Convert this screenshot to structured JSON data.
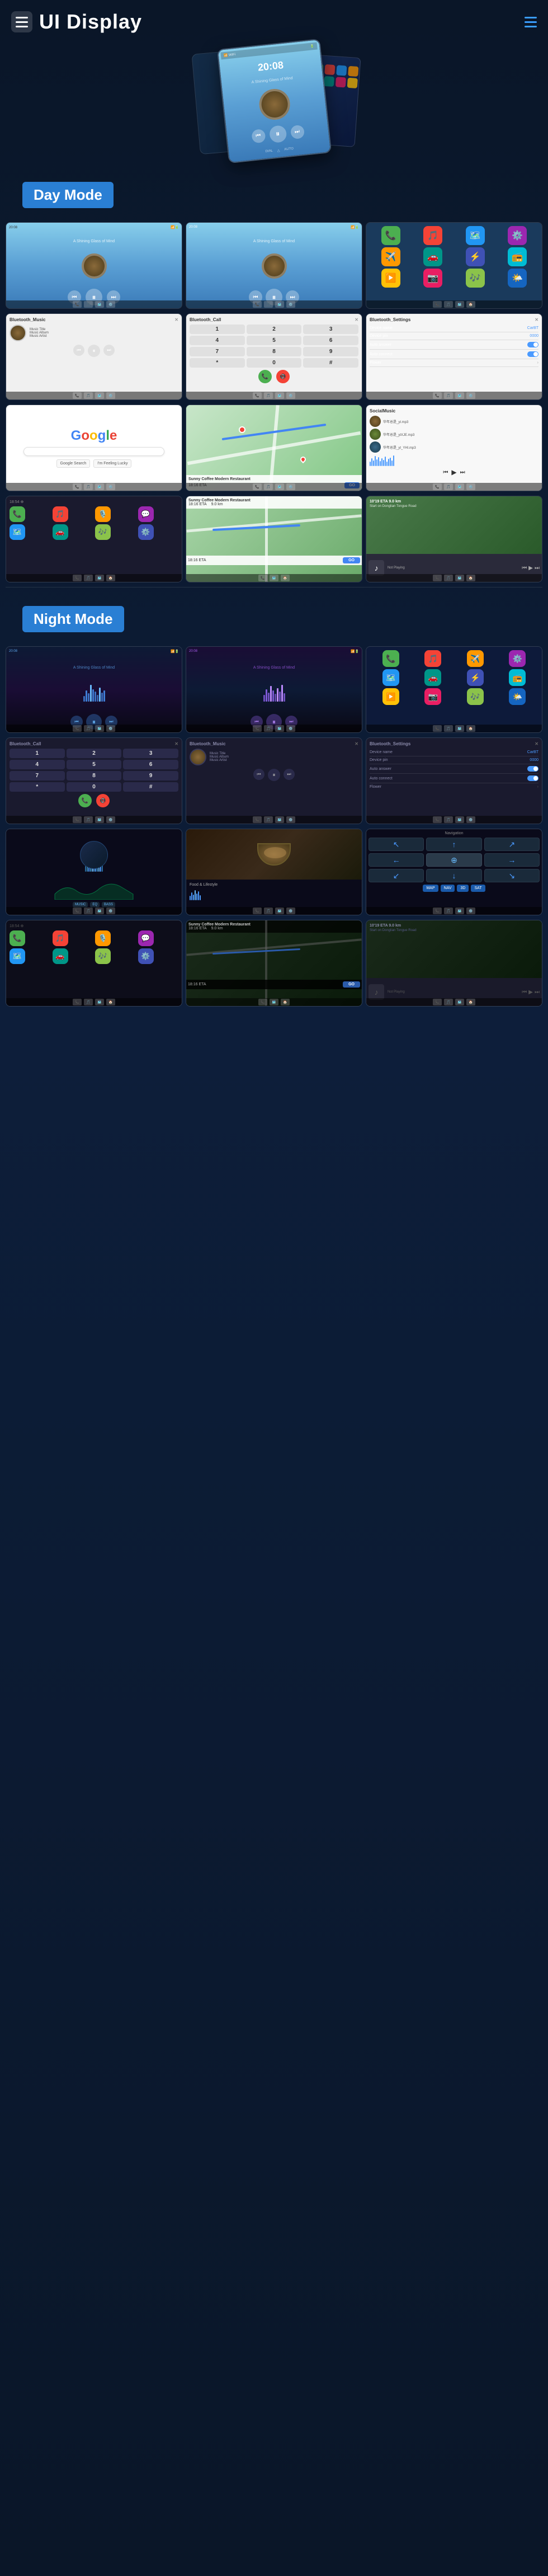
{
  "header": {
    "title": "UI Display",
    "menu_icon_label": "Menu",
    "hamburger_label": "Hamburger Menu"
  },
  "day_mode": {
    "label": "Day Mode",
    "screens": [
      {
        "id": "day-music-1",
        "type": "music",
        "time": "20:08",
        "desc": "Day music player 1"
      },
      {
        "id": "day-music-2",
        "type": "music",
        "time": "20:08",
        "desc": "Day music player 2"
      },
      {
        "id": "day-apps",
        "type": "apps",
        "desc": "App grid"
      },
      {
        "id": "day-bt-music",
        "type": "bt-music",
        "title": "Bluetooth_Music",
        "desc": "Bluetooth music"
      },
      {
        "id": "day-bt-call",
        "type": "bt-call",
        "title": "Bluetooth_Call",
        "desc": "Bluetooth call"
      },
      {
        "id": "day-bt-settings",
        "type": "bt-settings",
        "title": "Bluetooth_Settings",
        "desc": "Bluetooth settings"
      },
      {
        "id": "day-google",
        "type": "google",
        "desc": "Google screen"
      },
      {
        "id": "day-map",
        "type": "map",
        "desc": "Navigation map"
      },
      {
        "id": "day-social",
        "type": "social",
        "title": "SocialMusic",
        "desc": "Social music"
      }
    ],
    "carplay_screens": [
      {
        "id": "day-carplay-apps",
        "type": "carplay-apps",
        "desc": "CarPlay apps"
      },
      {
        "id": "day-carplay-nav",
        "type": "carplay-nav",
        "desc": "CarPlay navigation"
      },
      {
        "id": "day-carplay-music",
        "type": "carplay-music",
        "desc": "CarPlay music"
      }
    ]
  },
  "night_mode": {
    "label": "Night Mode",
    "screens": [
      {
        "id": "night-music-1",
        "type": "night-music",
        "time": "20:08",
        "desc": "Night music player 1"
      },
      {
        "id": "night-music-2",
        "type": "night-music",
        "time": "20:08",
        "desc": "Night music player 2"
      },
      {
        "id": "night-apps",
        "type": "night-apps",
        "desc": "Night app grid"
      },
      {
        "id": "night-bt-call",
        "type": "night-bt-call",
        "title": "Bluetooth_Call",
        "desc": "Night BT call"
      },
      {
        "id": "night-bt-music",
        "type": "night-bt-music",
        "title": "Bluetooth_Music",
        "desc": "Night BT music"
      },
      {
        "id": "night-bt-settings",
        "type": "night-bt-settings",
        "title": "Bluetooth_Settings",
        "desc": "Night BT settings"
      },
      {
        "id": "night-custom1",
        "type": "night-custom1",
        "desc": "Night custom screen 1"
      },
      {
        "id": "night-food",
        "type": "night-food",
        "desc": "Night food screen"
      },
      {
        "id": "night-map2",
        "type": "night-map2",
        "desc": "Night map 2"
      }
    ],
    "carplay_screens": [
      {
        "id": "night-carplay-apps",
        "type": "night-carplay-apps",
        "desc": "Night CarPlay apps"
      },
      {
        "id": "night-carplay-nav",
        "type": "night-carplay-nav",
        "desc": "Night CarPlay nav"
      },
      {
        "id": "night-carplay-music",
        "type": "night-carplay-music",
        "desc": "Night CarPlay music"
      }
    ]
  },
  "music_info": {
    "title": "Music Title",
    "album": "Music Album",
    "artist": "Music Artist"
  },
  "bt_settings": {
    "device_name_label": "Device name",
    "device_name_value": "CarBT",
    "device_pin_label": "Device pin",
    "device_pin_value": "0000",
    "auto_answer_label": "Auto answer",
    "auto_connect_label": "Auto connect",
    "flower_label": "Flower"
  },
  "map_info": {
    "restaurant": "Sunny Coffee Modern Restaurant",
    "eta_label": "18:16 ETA",
    "distance": "9.0 km",
    "go_button": "GO"
  },
  "nav_info": {
    "start": "Start on Donglian Tongue Road",
    "not_playing": "Not Playing"
  },
  "icons": {
    "phone": "📞",
    "music": "🎵",
    "maps": "🗺️",
    "settings": "⚙️",
    "messages": "💬",
    "camera": "📷",
    "photos": "🖼️",
    "apps": "⋯",
    "bluetooth": "⚡",
    "wifi": "📶",
    "back": "◀",
    "play": "▶",
    "pause": "⏸",
    "prev": "⏮",
    "next": "⏭",
    "search": "🔍",
    "home": "🏠",
    "car": "🚗"
  }
}
